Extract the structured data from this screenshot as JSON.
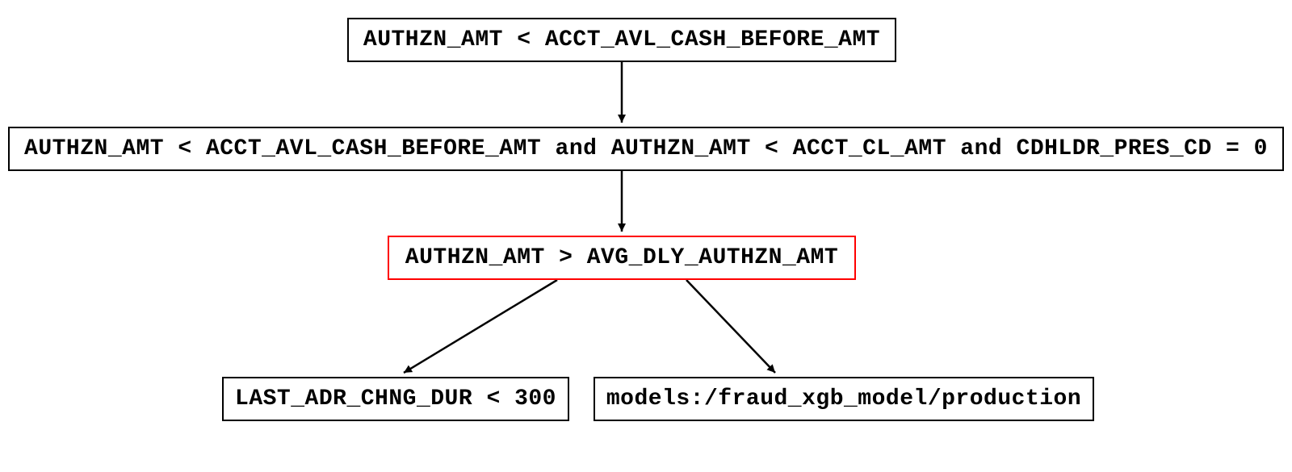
{
  "diagram": {
    "type": "decision-tree",
    "nodes": {
      "root": {
        "label": "AUTHZN_AMT < ACCT_AVL_CASH_BEFORE_AMT",
        "highlighted": false
      },
      "rule2": {
        "label": "AUTHZN_AMT < ACCT_AVL_CASH_BEFORE_AMT and AUTHZN_AMT < ACCT_CL_AMT and CDHLDR_PRES_CD = 0",
        "highlighted": false
      },
      "rule3": {
        "label": "AUTHZN_AMT > AVG_DLY_AUTHZN_AMT",
        "highlighted": true
      },
      "leafL": {
        "label": "LAST_ADR_CHNG_DUR < 300",
        "highlighted": false
      },
      "leafR": {
        "label": "models:/fraud_xgb_model/production",
        "highlighted": false
      }
    },
    "edges": [
      {
        "from": "root",
        "to": "rule2"
      },
      {
        "from": "rule2",
        "to": "rule3"
      },
      {
        "from": "rule3",
        "to": "leafL"
      },
      {
        "from": "rule3",
        "to": "leafR"
      }
    ],
    "colors": {
      "border_default": "#000000",
      "border_highlight": "#ff0000",
      "background": "#ffffff"
    }
  }
}
